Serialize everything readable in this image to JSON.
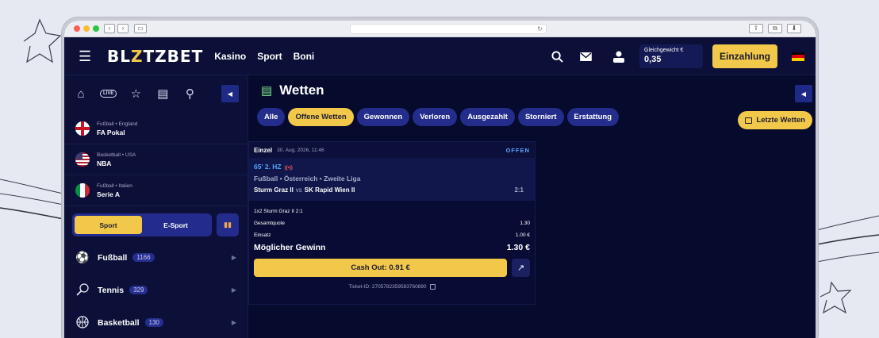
{
  "browser": {
    "reload_glyph": "↻"
  },
  "nav": {
    "logo_a": "BL",
    "logo_z": "Z",
    "logo_b": "TZBET",
    "links": [
      "Kasino",
      "Sport",
      "Boni"
    ],
    "balance_label": "Gleichgewicht €",
    "balance_value": "0,35",
    "deposit_label": "Einzahlung"
  },
  "sidebar": {
    "live_label": "LIVE",
    "leagues": [
      {
        "meta": "Fußball • England",
        "name": "FA Pokal",
        "flag": "england"
      },
      {
        "meta": "Basketball • USA",
        "name": "NBA",
        "flag": "usa"
      },
      {
        "meta": "Fußball • Italien",
        "name": "Serie A",
        "flag": "italy"
      }
    ],
    "toggle": {
      "sport": "Sport",
      "esport": "E-Sport"
    },
    "sports": [
      {
        "label": "Fußball",
        "count": "1166",
        "icon": "soccer-ball-icon"
      },
      {
        "label": "Tennis",
        "count": "329",
        "icon": "tennis-racket-icon"
      },
      {
        "label": "Basketball",
        "count": "130",
        "icon": "basketball-icon"
      }
    ]
  },
  "main": {
    "title": "Wetten",
    "filters": [
      "Alle",
      "Offene Wetten",
      "Gewonnen",
      "Verloren",
      "Ausgezahlt",
      "Storniert",
      "Erstattung"
    ],
    "active_filter": "Offene Wetten",
    "recent_label": "Letzte Wetten"
  },
  "ticket": {
    "kind": "Einzel",
    "date": "30. Aug. 2026, 11:46",
    "status": "OFFEN",
    "live_time": "65' 2. HZ",
    "league": "Fußball • Österreich • Zweite Liga",
    "home": "Sturm Graz II",
    "vs": "vs",
    "away": "SK Rapid Wien II",
    "score": "2:1",
    "selection": "1x2 Sturm Graz II  2:1",
    "odds_label": "Gesamtquote",
    "odds_value": "1.30",
    "stake_label": "Einsatz",
    "stake_value": "1.00 €",
    "win_label": "Möglicher Gewinn",
    "win_value": "1.30 €",
    "cashout_label": "Cash Out: 0.91 €",
    "ticket_id": "Ticket-ID: 2705782359583760890"
  },
  "colors": {
    "brand_yellow": "#f2c84b",
    "nav_bg": "#0c1038",
    "chip_bg": "#242d8c",
    "status_blue": "#5fa4ff"
  }
}
